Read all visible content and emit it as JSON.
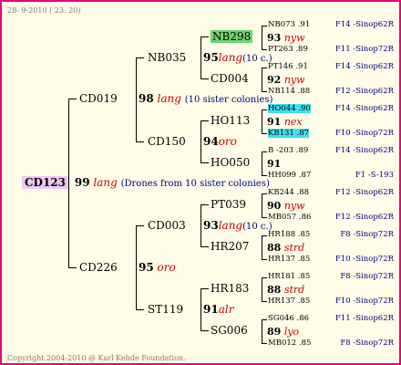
{
  "header_date": "28- 9-2010 ( 23: 20)",
  "footer": "Copyright 2004-2010 @ Karl Kehde Foundation.",
  "root": {
    "id": "CD123",
    "num": "99",
    "race": "lang",
    "note": "(Drones from 10 sister colonies)"
  },
  "gen1": [
    {
      "id": "CD019",
      "num": "98",
      "race": "lang",
      "note": "(10 sister colonies)"
    },
    {
      "id": "CD226",
      "num": "95",
      "race": "oro",
      "note": ""
    }
  ],
  "gen2": [
    {
      "id": "NB035",
      "num": "95",
      "race": "lang",
      "note": "(10 c.)"
    },
    {
      "id": "CD150",
      "num": "94",
      "race": "oro",
      "note": ""
    },
    {
      "id": "CD003",
      "num": "93",
      "race": "lang",
      "note": "(10 c.)"
    },
    {
      "id": "ST119",
      "num": "91",
      "race": "alr",
      "note": ""
    }
  ],
  "gen3": [
    {
      "id": "NB298",
      "num": "93",
      "race": "nyw"
    },
    {
      "id": "CD004",
      "num": "92",
      "race": "nyw"
    },
    {
      "id": "HO113",
      "num": "91",
      "race": "nex"
    },
    {
      "id": "HO050",
      "num": "91",
      "race": ""
    },
    {
      "id": "PT039",
      "num": "90",
      "race": "nyw"
    },
    {
      "id": "HR207",
      "num": "88",
      "race": "strd"
    },
    {
      "id": "HR183",
      "num": "88",
      "race": "strd"
    },
    {
      "id": "SG006",
      "num": "89",
      "race": "lyo"
    }
  ],
  "gen4": [
    {
      "id": "NB073",
      "val": ".91",
      "sp": "F14 -Sinop62R"
    },
    {
      "id": "PT263",
      "val": ".89",
      "sp": "F11 -Sinop72R"
    },
    {
      "id": "PT146",
      "val": ".91",
      "sp": "F14 -Sinop62R"
    },
    {
      "id": "NB114",
      "val": ".88",
      "sp": "F12 -Sinop62R"
    },
    {
      "id": "HO044",
      "val": ".90",
      "sp": "F14 -Sinop62R"
    },
    {
      "id": "KB131",
      "val": ".87",
      "sp": "F10 -Sinop72R"
    },
    {
      "id": "B -203",
      "val": ".89",
      "sp": "F14 -Sinop62R"
    },
    {
      "id": "HH099",
      "val": ".87",
      "sp": "F1 -S-193"
    },
    {
      "id": "KB244",
      "val": ".88",
      "sp": "F12 -Sinop62R"
    },
    {
      "id": "MB057",
      "val": ".86",
      "sp": "F12 -Sinop62R"
    },
    {
      "id": "HR188",
      "val": ".85",
      "sp": "F8 -Sinop72R"
    },
    {
      "id": "HR137",
      "val": ".85",
      "sp": "F10 -Sinop72R"
    },
    {
      "id": "HR181",
      "val": ".85",
      "sp": "F8 -Sinop72R"
    },
    {
      "id": "HR137",
      "val": ".85",
      "sp": "F10 -Sinop72R"
    },
    {
      "id": "SG046",
      "val": ".86",
      "sp": "F11 -Sinop62R"
    },
    {
      "id": "MB012",
      "val": ".85",
      "sp": "F8 -Sinop72R"
    }
  ],
  "colors": {
    "frame": "#e8007a",
    "background": "#fffde8",
    "race": "#cc0000",
    "species": "#000080",
    "highlight_green": "#6dd66d",
    "highlight_cyan": "#40e0f0",
    "highlight_pink": "#f0c8f0"
  }
}
